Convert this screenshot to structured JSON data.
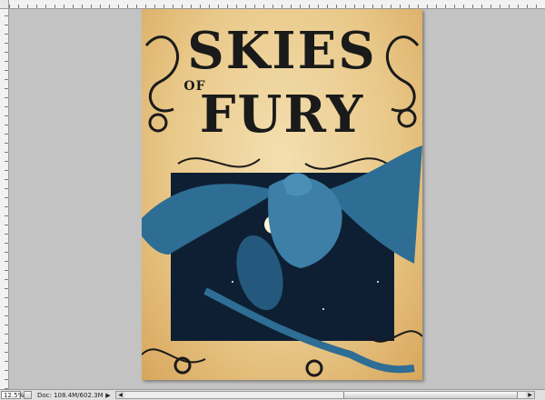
{
  "artwork": {
    "title_line1": "SKIES",
    "title_of": "OF",
    "title_line2": "FURY",
    "colors": {
      "parchment": "#e9c98a",
      "ink": "#1a1a1a",
      "night": "#0e1f33",
      "griffin": "#2e6d94",
      "moon": "#fff4d6"
    }
  },
  "statusbar": {
    "zoom": "12.5%",
    "doc_info": "Doc: 108.4M/602.3M",
    "arrow": "▶"
  },
  "scrollbar": {
    "left_arrow": "◀",
    "right_arrow": "▶"
  },
  "icons": {
    "status_menu": "status-menu-icon",
    "scroll_left": "arrow-left-icon",
    "scroll_right": "arrow-right-icon"
  }
}
